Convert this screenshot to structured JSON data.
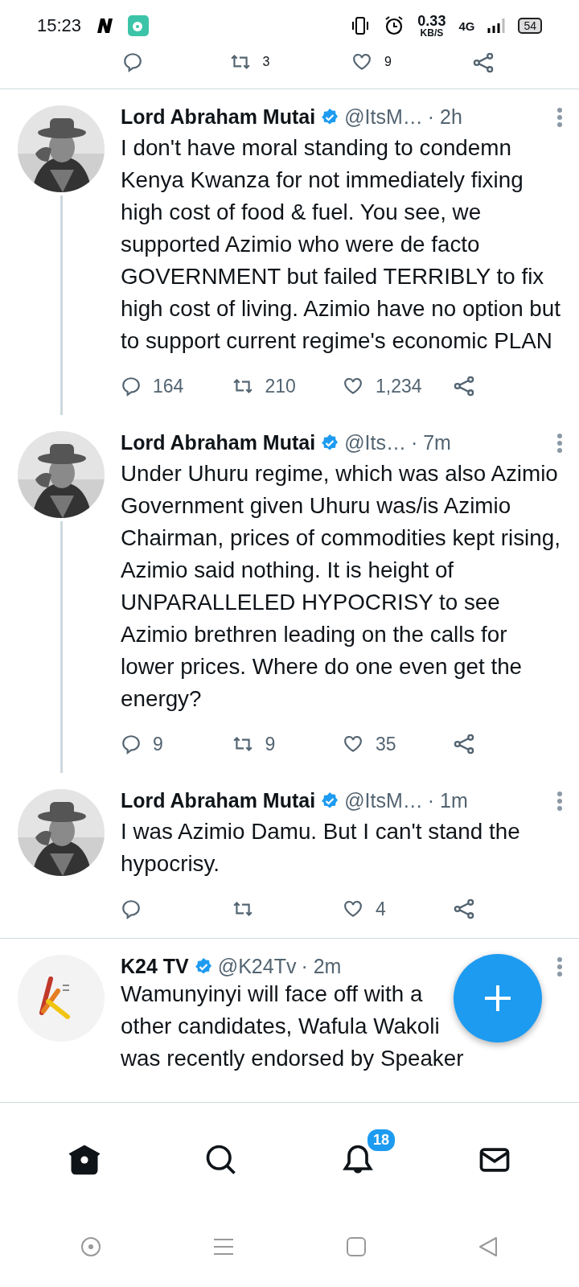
{
  "status_bar": {
    "time": "15:23",
    "speed": "0.33",
    "speed_unit": "KB/S",
    "network": "4G",
    "battery": "54"
  },
  "previous_actions": {
    "retweet": "3",
    "like": "9"
  },
  "tweets": [
    {
      "name": "Lord Abraham Mutai",
      "handle": "@ItsM…",
      "time": "· 2h",
      "thread_continues": true,
      "text": "I don't have moral standing to condemn Kenya Kwanza for not immediately fixing high cost of food & fuel. You see, we supported Azimio who were de facto GOVERNMENT but failed TERRIBLY to fix high cost of living. Azimio have no option but to support current regime's economic PLAN",
      "replies": "164",
      "retweets": "210",
      "likes": "1,234"
    },
    {
      "name": "Lord Abraham Mutai",
      "handle": "@Its…",
      "time": "· 7m",
      "thread_continues": true,
      "text": "Under Uhuru regime, which was also Azimio Government given Uhuru was/is Azimio Chairman, prices of commodities kept rising, Azimio said nothing. It is height of UNPARALLELED HYPOCRISY to see Azimio brethren leading on the calls for lower prices. Where do one even get the energy?",
      "replies": "9",
      "retweets": "9",
      "likes": "35"
    },
    {
      "name": "Lord Abraham Mutai",
      "handle": "@ItsM…",
      "time": "· 1m",
      "thread_continues": false,
      "text": "I was Azimio Damu. But I can't stand the hypocrisy.",
      "likes": "4"
    }
  ],
  "partial_tweet": {
    "name": "K24 TV",
    "handle": "@K24Tv",
    "time": "· 2m",
    "lines": [
      "Wamunyinyi will face off with a",
      "other candidates, Wafula Wakoli",
      "was recently endorsed by Speaker"
    ]
  },
  "bottom_nav": [
    {
      "kind": "home",
      "selected": true
    },
    {
      "kind": "search",
      "selected": false
    },
    {
      "kind": "notifications",
      "selected": false,
      "badge": "18"
    },
    {
      "kind": "messages",
      "selected": false
    }
  ]
}
